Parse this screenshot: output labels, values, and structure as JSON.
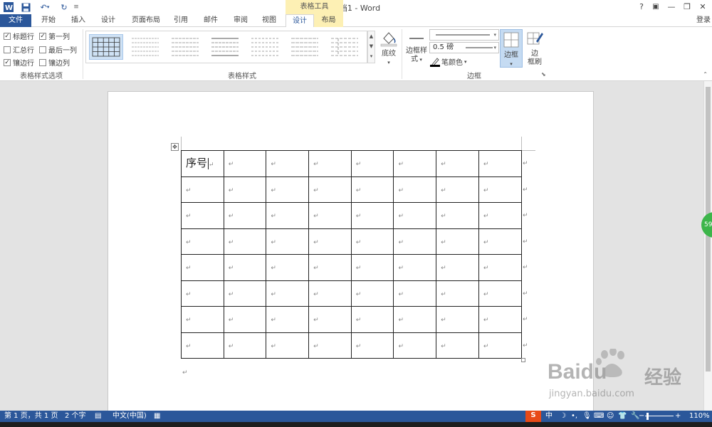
{
  "titlebar": {
    "window_title": "文档1 - Word",
    "context_group": "表格工具",
    "help": "?",
    "ribbon_display": "▣",
    "minimize": "—",
    "restore": "❐",
    "close": "✕"
  },
  "tabs": [
    {
      "label": "文件"
    },
    {
      "label": "开始"
    },
    {
      "label": "插入"
    },
    {
      "label": "设计"
    },
    {
      "label": "页面布局"
    },
    {
      "label": "引用"
    },
    {
      "label": "邮件"
    },
    {
      "label": "审阅"
    },
    {
      "label": "视图"
    },
    {
      "label": "设计"
    },
    {
      "label": "布局"
    }
  ],
  "signin": "登录",
  "style_options": {
    "group_label": "表格样式选项",
    "items": [
      {
        "label": "标题行",
        "checked": true
      },
      {
        "label": "第一列",
        "checked": true
      },
      {
        "label": "汇总行",
        "checked": false
      },
      {
        "label": "最后一列",
        "checked": false
      },
      {
        "label": "镶边行",
        "checked": true
      },
      {
        "label": "镶边列",
        "checked": false
      }
    ]
  },
  "table_styles": {
    "group_label": "表格样式",
    "shading_label": "底纹"
  },
  "borders": {
    "group_label": "边框",
    "border_styles_label_1": "边框样",
    "border_styles_label_2": "式",
    "weight_value": "0.5 磅",
    "pen_color_label": "笔颜色",
    "borders_label": "边框",
    "painter_label_1": "边",
    "painter_label_2": "框刷"
  },
  "document": {
    "table": {
      "first_cell": "序号",
      "rows": 8,
      "cols": 8,
      "empty_mark": "↵"
    },
    "end_mark": "↵"
  },
  "statusbar": {
    "page": "第 1 页，共 1 页",
    "words": "2 个字",
    "language": "中文(中国)",
    "zoom": "110%",
    "zoom_out": "−",
    "zoom_in": "+"
  },
  "overlays": {
    "bubble_count": "59",
    "watermark_brand": "Baidu",
    "watermark_text": "经验",
    "watermark_url": "jingyan.baidu.com"
  }
}
